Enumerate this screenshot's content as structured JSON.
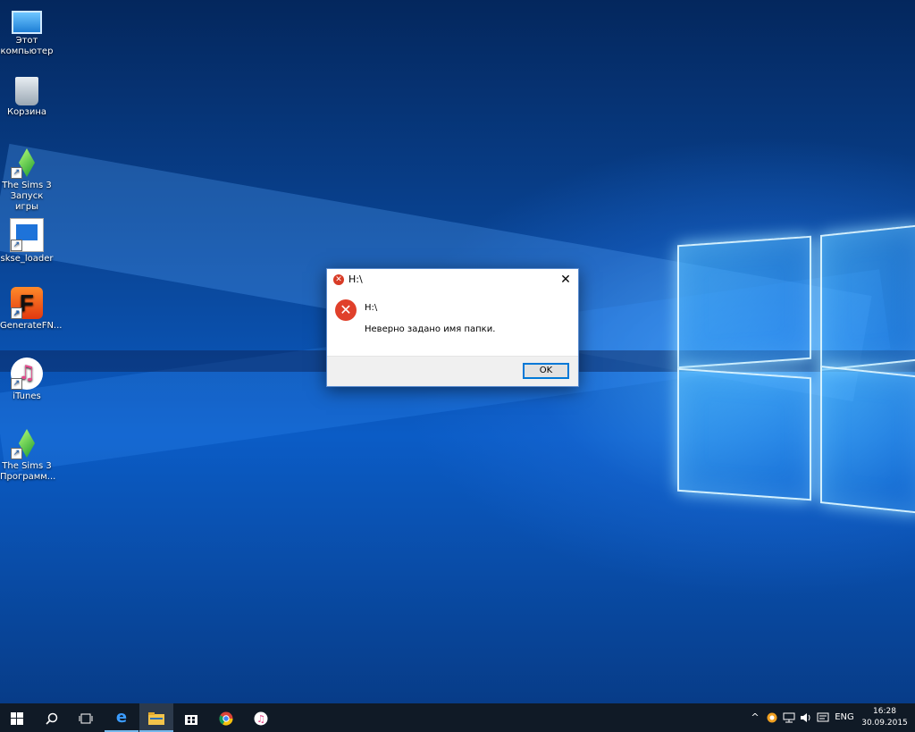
{
  "desktop": {
    "icons": [
      {
        "label_line1": "Этот",
        "label_line2": "компьютер",
        "icon": "this-pc-icon"
      },
      {
        "label_line1": "Корзина",
        "label_line2": "",
        "icon": "recycle-bin-icon"
      },
      {
        "label_line1": "The Sims 3",
        "label_line2": "Запуск игры",
        "icon": "sims3-icon"
      },
      {
        "label_line1": "skse_loader",
        "label_line2": "",
        "icon": "skse-loader-icon"
      },
      {
        "label_line1": "GenerateFN...",
        "label_line2": "",
        "icon": "generatefn-icon"
      },
      {
        "label_line1": "iTunes",
        "label_line2": "",
        "icon": "itunes-icon"
      },
      {
        "label_line1": "The Sims 3",
        "label_line2": "Программ...",
        "icon": "sims3-icon"
      }
    ]
  },
  "dialog": {
    "title": "H:\\",
    "close_glyph": "✕",
    "heading": "H:\\",
    "message": "Неверно задано имя папки.",
    "ok_label": "OK"
  },
  "taskbar": {
    "language": "ENG",
    "time": "16:28",
    "date": "30.09.2015"
  },
  "colors": {
    "error_red": "#e0402b",
    "accent_blue": "#0078d7",
    "taskbar": "#101a26"
  }
}
